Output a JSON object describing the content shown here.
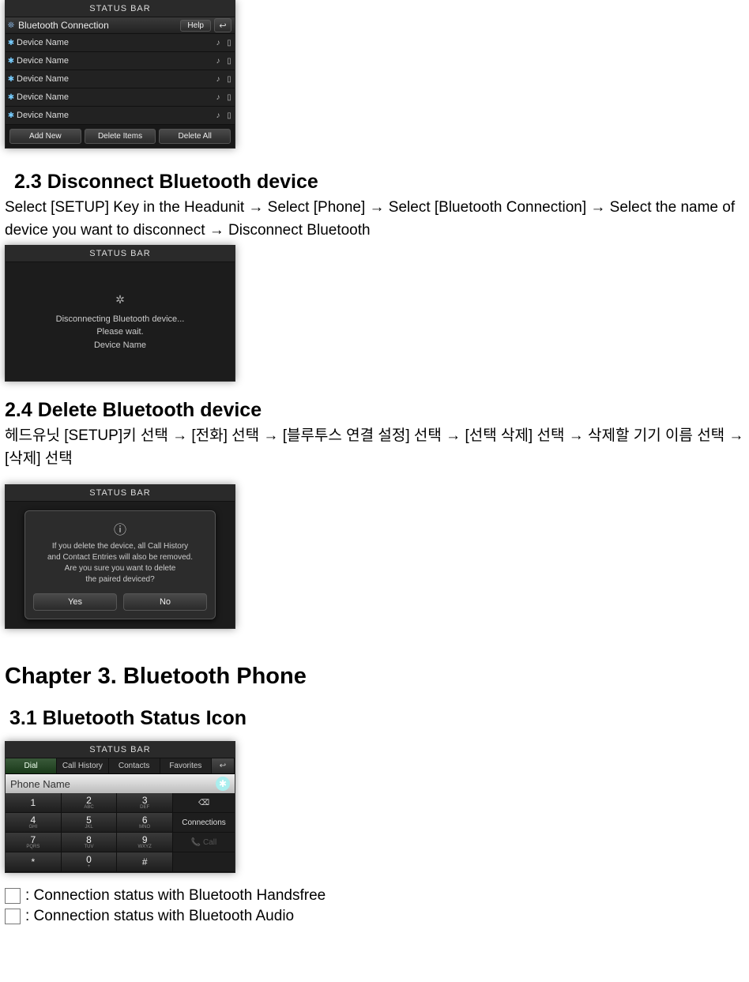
{
  "screens": {
    "status_bar": "STATUS BAR",
    "list": {
      "title": "Bluetooth Connection",
      "help": "Help",
      "devices": [
        "Device Name",
        "Device Name",
        "Device Name",
        "Device Name",
        "Device Name"
      ],
      "buttons": {
        "add": "Add New",
        "del": "Delete Items",
        "all": "Delete All"
      }
    },
    "disc": {
      "line1": "Disconnecting Bluetooth device...",
      "line2": "Please wait.",
      "line3": "Device Name"
    },
    "deldlg": {
      "msg1": "If you delete the device, all Call History",
      "msg2": "and Contact Entries will also be removed.",
      "msg3": "Are you sure you want to delete",
      "msg4": "the paired deviced?",
      "yes": "Yes",
      "no": "No"
    },
    "dial": {
      "tabs": {
        "dial": "Dial",
        "ch": "Call History",
        "co": "Contacts",
        "fav": "Favorites"
      },
      "phone_name": "Phone Name",
      "keys": [
        {
          "d": "1",
          "s": ""
        },
        {
          "d": "2",
          "s": "ABC"
        },
        {
          "d": "3",
          "s": "DEF"
        },
        {
          "d": "4",
          "s": "GHI"
        },
        {
          "d": "5",
          "s": "JKL"
        },
        {
          "d": "6",
          "s": "MNO"
        },
        {
          "d": "7",
          "s": "PQRS"
        },
        {
          "d": "8",
          "s": "TUV"
        },
        {
          "d": "9",
          "s": "WXYZ"
        },
        {
          "d": "*",
          "s": ""
        },
        {
          "d": "0",
          "s": "+"
        },
        {
          "d": "#",
          "s": ""
        }
      ],
      "side": {
        "del": "⌫",
        "conn": "Connections",
        "call": "📞 Call"
      }
    }
  },
  "text": {
    "h23": "2.3 Disconnect Bluetooth device",
    "p23": "Select [SETUP] Key in the Headunit → Select [Phone] → Select [Bluetooth Connection] → Select the name of device you want to disconnect → Disconnect Bluetooth",
    "h24": "2.4 Delete Bluetooth device",
    "p24": "헤드유닛 [SETUP]키 선택 → [전화] 선택 → [블루투스 연결 설정] 선택 → [선택 삭제] 선택 → 삭제할 기기 이름 선택 → [삭제] 선택",
    "hchap": "Chapter 3. Bluetooth Phone",
    "h31": "3.1 Bluetooth Status Icon",
    "legend1": " : Connection status with Bluetooth Handsfree",
    "legend2": " : Connection status with Bluetooth Audio"
  }
}
